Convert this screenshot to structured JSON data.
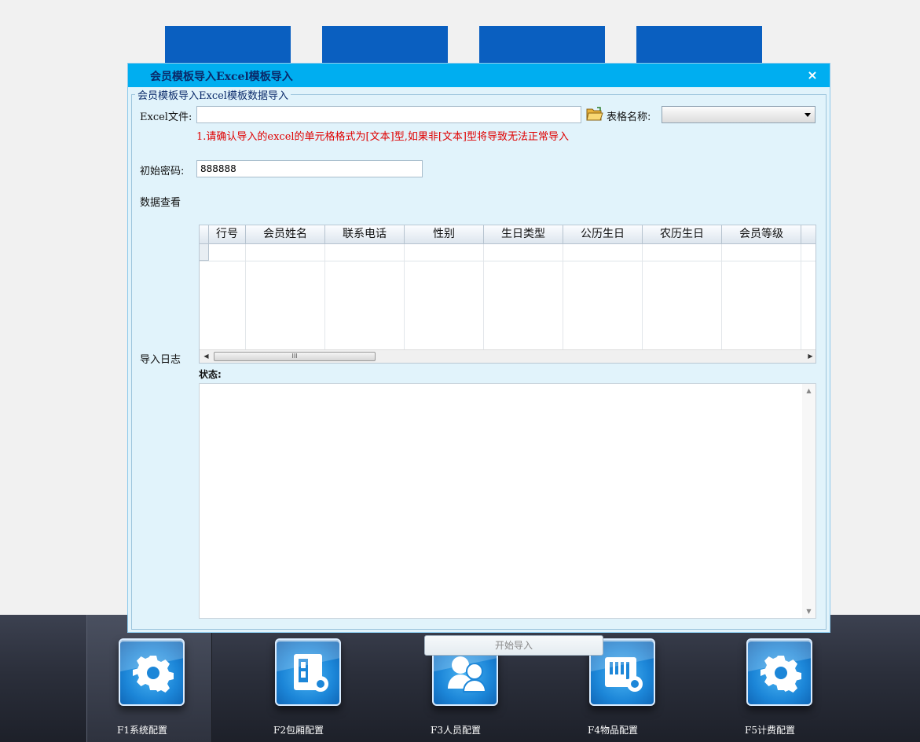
{
  "dialog": {
    "title": "会员模板导入Excel模板导入",
    "close_icon": "×",
    "group_title": "会员模板导入Excel模板数据导入",
    "excel_file_label": "Excel文件:",
    "excel_file_value": "",
    "sheet_name_label": "表格名称:",
    "sheet_name_value": "",
    "warning": "1.请确认导入的excel的单元格格式为[文本]型,如果非[文本]型将导致无法正常导入",
    "initial_password_label": "初始密码:",
    "initial_password_value": "888888",
    "data_view_label": "数据查看",
    "import_log_label": "导入日志",
    "status_label": "状态:",
    "start_button": "开始导入"
  },
  "grid": {
    "columns": [
      "行号",
      "会员姓名",
      "联系电话",
      "性别",
      "生日类型",
      "公历生日",
      "农历生日",
      "会员等级"
    ],
    "scroll_thumb_grip": "III"
  },
  "taskbar": {
    "items": [
      {
        "label": "F1系统配置",
        "icon": "gear-icon",
        "active": true
      },
      {
        "label": "F2包厢配置",
        "icon": "room-gear-icon",
        "active": false
      },
      {
        "label": "F3人员配置",
        "icon": "users-icon",
        "active": false
      },
      {
        "label": "F4物品配置",
        "icon": "goods-gear-icon",
        "active": false
      },
      {
        "label": "F5计费配置",
        "icon": "gear-icon",
        "active": false
      }
    ]
  },
  "colors": {
    "title_bar": "#00aef0",
    "dialog_bg": "#e1f3fb",
    "tab_blue": "#0a5fc0",
    "warning_text": "#e00000"
  }
}
